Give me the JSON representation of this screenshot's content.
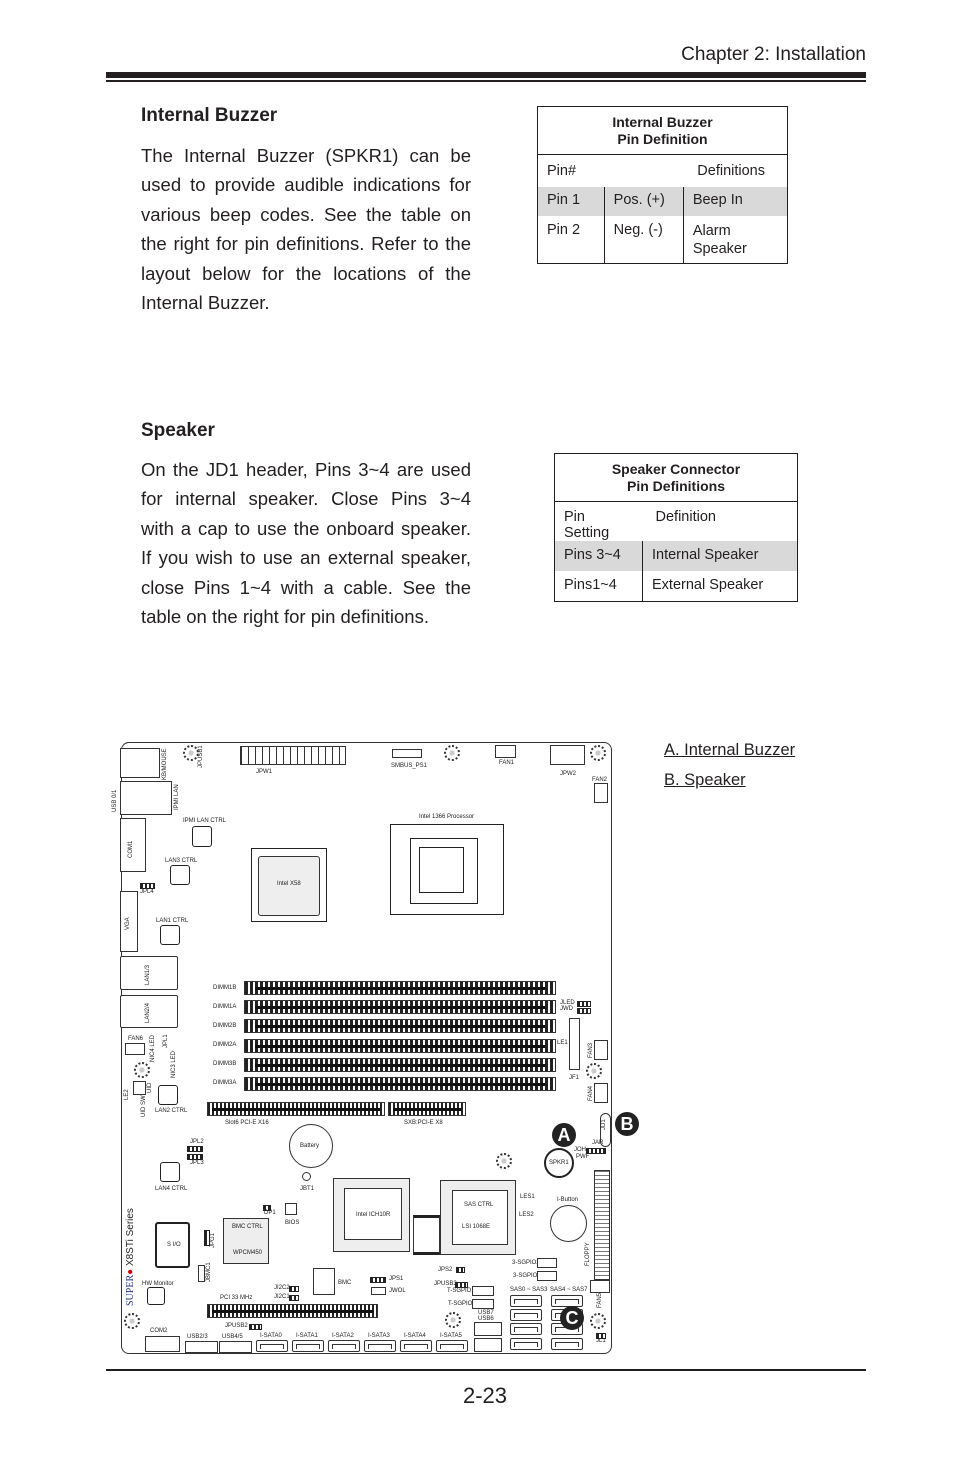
{
  "header": {
    "chapter": "Chapter 2: Installation"
  },
  "buzzer": {
    "heading": "Internal Buzzer",
    "text": "The Internal Buzzer (SPKR1) can be used to provide audible indications for various beep codes. See the table on the right for pin definitions. Refer to the layout below for the locations of the Internal Buzzer.",
    "table": {
      "title1": "Internal Buzzer",
      "title2": "Pin Definition",
      "col1": "Pin#",
      "col2": "Definitions",
      "rows": [
        {
          "pin": "Pin 1",
          "sig": "Pos. (+)",
          "def": "Beep In"
        },
        {
          "pin": "Pin 2",
          "sig": "Neg. (-)",
          "def": "Alarm Speaker"
        }
      ]
    }
  },
  "speaker": {
    "heading": "Speaker",
    "text": "On the JD1 header, Pins 3~4 are used for internal speaker. Close Pins 3~4 with a cap to use the onboard speaker. If you wish to use an external speaker, close Pins 1~4 with a cable. See the table on the right for pin definitions.",
    "table": {
      "title1": "Speaker Connector",
      "title2": "Pin Definitions",
      "col1": "Pin Setting",
      "col2": "Definition",
      "rows": [
        {
          "pin": "Pins 3~4",
          "def": "Internal Speaker"
        },
        {
          "pin": "Pins1~4",
          "def": "External Speaker"
        }
      ]
    }
  },
  "legend": {
    "a": "A. Internal Buzzer",
    "b": "B. Speaker"
  },
  "board": {
    "kb": "KB/MOUSE",
    "jpusb1": "JPUSB1",
    "jpw1": "JPW1",
    "smbus": "SMBUS_PS1",
    "fan1": "FAN1",
    "jpw2": "JPW2",
    "fan2": "FAN2",
    "usb01": "USB 0/1",
    "ipmilan": "IPMI LAN",
    "ipmictrl": "IPMI LAN CTRL",
    "com1": "COM1",
    "lan3ctrl": "LAN3 CTRL",
    "jpl4": "JPL4",
    "vga": "VGA",
    "lan1ctrl": "LAN1 CTRL",
    "x58": "Intel X58",
    "cpu": "Intel 1366 Processor",
    "lan13": "LAN1/3",
    "lan24": "LAN2/4",
    "dimms": [
      "DIMM1B",
      "DIMM1A",
      "DIMM2B",
      "DIMM2A",
      "DIMM3B",
      "DIMM3A"
    ],
    "jled": "JLED",
    "jwd": "JWD",
    "le1": "LE1",
    "jf1": "JF1",
    "fan3": "FAN3",
    "fan4": "FAN4",
    "fan6": "FAN6",
    "nic4": "NIC4 LED",
    "jpl1": "JPL1",
    "nic3": "NIC3 LED",
    "uid": "UID",
    "uidsw": "UID SW",
    "le2": "LE2",
    "lan2ctrl": "LAN2 CTRL",
    "slot6": "Slot6 PCI-E X16",
    "sxb": "SXB:PCI-E X8",
    "battery": "Battery",
    "jd1": "JD1",
    "jar": "JAR",
    "joh": "JOH",
    "pwf": "PWF",
    "spkr1": "SPKR1",
    "jpl2": "JPL2",
    "jpl3": "JPL3",
    "lan4ctrl": "LAN4 CTRL",
    "jbt1": "JBT1",
    "dp1": "DP1",
    "bios": "BIOS",
    "jpg1": "JPG1",
    "bmcctrl": "BMC CTRL",
    "wpcm": "WPCM450",
    "sio": "S I/O",
    "jbmc1": "JBMC1",
    "hwmon": "HW Monitor",
    "brand_super": "SUPER",
    "brand_series": "X8STi Series",
    "ich": "Intel ICH10R",
    "sasctrl": "SAS CTRL",
    "lsi": "LSI 1068E",
    "les1": "LES1",
    "les2": "LES2",
    "ibutton": "I-Button",
    "floppy": "FLOPPY",
    "jps2": "JPS2",
    "sgpio2": "3-SGPIO2",
    "sgpio1": "3-SGPIO1",
    "bmc": "BMC",
    "jps1": "JPS1",
    "jwol": "JWOL",
    "ji2c2": "JI2C2",
    "ji2c1": "JI2C1",
    "pci33": "PCI 33 MHz",
    "jpusb3": "JPUSB3",
    "tsgpio1": "T-SGPIO1",
    "tsgpio2": "T-SGPIO2",
    "sas03": "SAS0 ~ SAS3",
    "sas47": "SAS4 ~ SAS7",
    "fan5": "FAN5",
    "usb7": "USB7",
    "usb6": "USB6",
    "jpusb2": "JPUSB2",
    "com2": "COM2",
    "usb23": "USB2/3",
    "usb45": "USB4/5",
    "isata": [
      "I-SATA0",
      "I-SATA1",
      "I-SATA2",
      "I-SATA3",
      "I-SATA4",
      "I-SATA5"
    ],
    "jl1": "JL1",
    "badge_a": "A",
    "badge_b": "B",
    "badge_c": "C"
  },
  "footer": {
    "page": "2-23"
  }
}
